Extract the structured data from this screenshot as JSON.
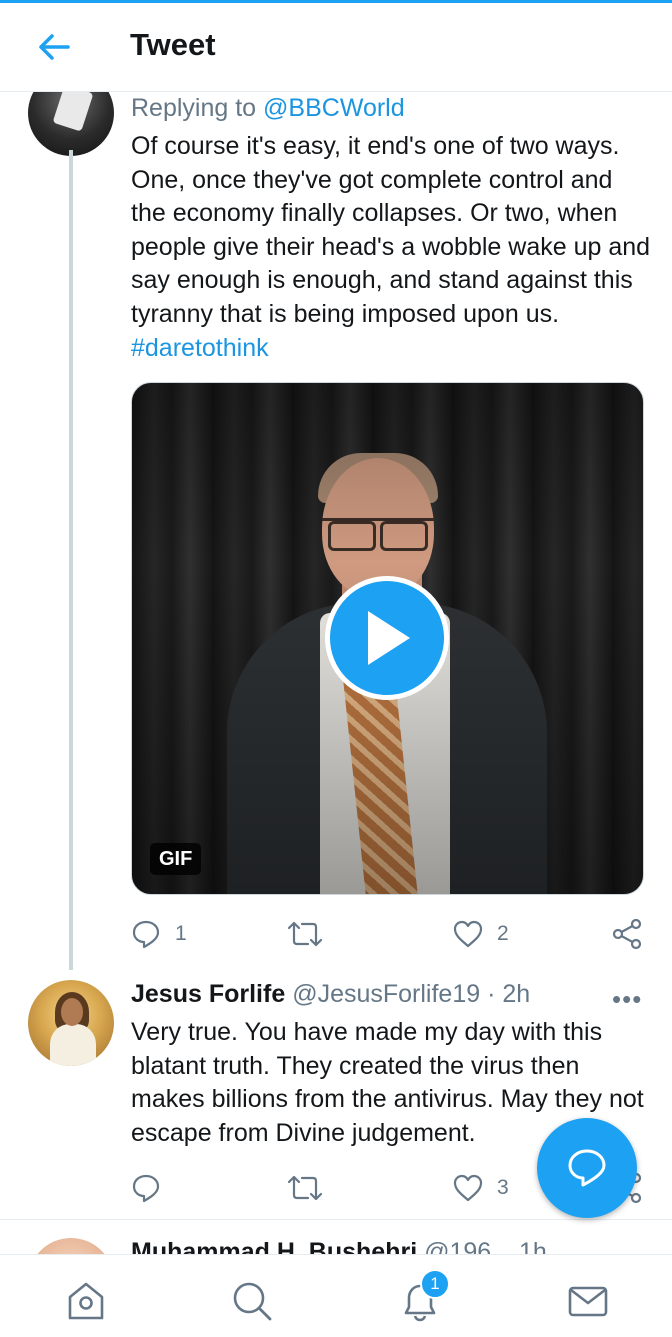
{
  "header": {
    "title": "Tweet"
  },
  "tweet": {
    "replying_prefix": "Replying to ",
    "replying_to": "@BBCWorld",
    "text": "Of course it's easy, it end's one of two ways. One, once they've got complete control and the economy finally collapses. Or two, when people give their head's a wobble wake up and say enough is enough, and stand against this tyranny that is being imposed upon us. ",
    "hashtag": "#daretothink",
    "media_badge": "GIF",
    "reply_count": "1",
    "retweet_count": "",
    "like_count": "2"
  },
  "reply": {
    "name": "Jesus Forlife",
    "handle": "@JesusForlife19",
    "separator": " · ",
    "time": "2h",
    "text": "Very true. You have made my day with this blatant truth. They created the virus then makes billions from the antivirus. May they not escape from Divine judgement.",
    "reply_count": "",
    "like_count": "3"
  },
  "next_reply": {
    "name": "Muhammad H. Bushehri",
    "handle": "@196...",
    "time": "1h"
  },
  "bottom_nav": {
    "notification_count": "1"
  },
  "colors": {
    "accent": "#1da1f2",
    "link": "#1b95e0",
    "muted": "#657786",
    "text": "#14171a"
  },
  "icons": [
    "back-arrow-icon",
    "play-icon",
    "reply-icon",
    "retweet-icon",
    "like-icon",
    "share-icon",
    "more-icon",
    "compose-reply-icon",
    "home-icon",
    "search-icon",
    "notifications-icon",
    "messages-icon"
  ]
}
